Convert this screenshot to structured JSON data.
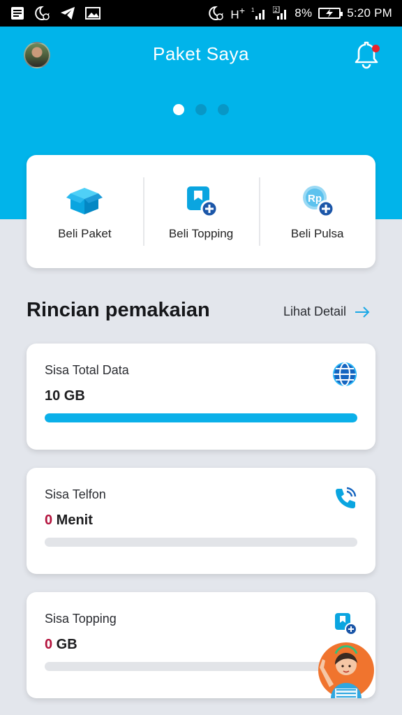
{
  "status_bar": {
    "network": "H",
    "network_plus": "+",
    "sim1": "1",
    "sim2": "2",
    "battery_percent": "8%",
    "time": "5:20 PM"
  },
  "header": {
    "title": "Paket Saya",
    "carousel_active_index": 0,
    "carousel_count": 3
  },
  "actions": [
    {
      "label": "Beli Paket",
      "icon": "box-icon"
    },
    {
      "label": "Beli Topping",
      "icon": "topping-add-icon"
    },
    {
      "label": "Beli Pulsa",
      "icon": "rp-add-icon"
    }
  ],
  "usage_section": {
    "title": "Rincian pemakaian",
    "detail_link": "Lihat Detail"
  },
  "usage": [
    {
      "label": "Sisa Total Data",
      "amount": "10 GB",
      "amount_number": "",
      "amount_unit": "",
      "icon": "globe-icon",
      "fill": 1.0
    },
    {
      "label": "Sisa Telfon",
      "amount": "",
      "amount_number": "0",
      "amount_unit": " Menit",
      "icon": "phone-icon",
      "fill": 0
    },
    {
      "label": "Sisa Topping",
      "amount": "",
      "amount_number": "0",
      "amount_unit": " GB",
      "icon": "topping-add-icon",
      "fill": 0
    }
  ],
  "colors": {
    "brand": "#01b4ea",
    "progress": "#0bb0e9",
    "zero_value": "#b3123c",
    "notification": "#e9222b"
  }
}
